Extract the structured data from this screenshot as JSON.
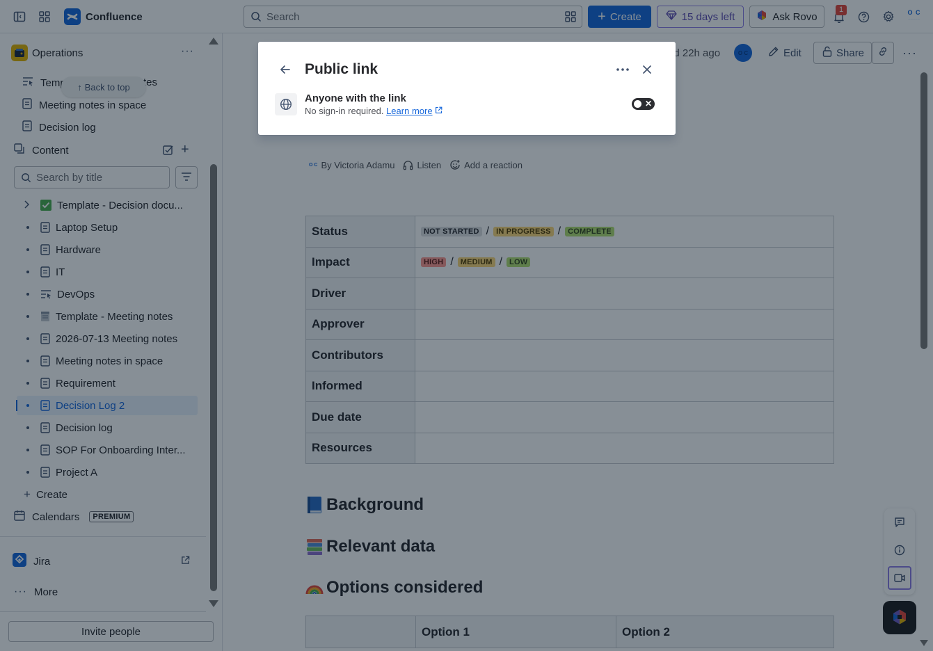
{
  "topbar": {
    "app_name": "Confluence",
    "search_placeholder": "Search",
    "create_label": "Create",
    "trial_label": "15 days left",
    "rovo_label": "Ask Rovo",
    "notification_count": "1",
    "avatar_initials": "O C"
  },
  "sidebar": {
    "space_name": "Operations",
    "nav_items": [
      {
        "label": "Templ",
        "icon": "template-icon"
      },
      {
        "label": "Meeting notes in space",
        "icon": "page-icon"
      },
      {
        "label": "Decision log",
        "icon": "page-icon"
      }
    ],
    "nav_item_0_suffix": "tes",
    "back_to_top": "Back to top",
    "content_label": "Content",
    "search_placeholder": "Search by title",
    "tree": [
      {
        "label": "Template - Decision docu...",
        "icon": "checkbox-icon",
        "expandable": true
      },
      {
        "label": "Laptop Setup",
        "icon": "page-icon"
      },
      {
        "label": "Hardware",
        "icon": "page-icon"
      },
      {
        "label": "IT",
        "icon": "page-icon"
      },
      {
        "label": "DevOps",
        "icon": "template-icon"
      },
      {
        "label": "Template - Meeting notes",
        "icon": "notepad-icon"
      },
      {
        "label": "2026-07-13 Meeting notes",
        "icon": "page-icon"
      },
      {
        "label": "Meeting notes in space",
        "icon": "page-icon"
      },
      {
        "label": "Requirement",
        "icon": "page-icon"
      },
      {
        "label": "Decision Log 2",
        "icon": "page-icon",
        "active": true
      },
      {
        "label": "Decision log",
        "icon": "page-icon"
      },
      {
        "label": "SOP For Onboarding Inter...",
        "icon": "page-icon"
      },
      {
        "label": "Project A",
        "icon": "page-icon"
      }
    ],
    "create_label": "Create",
    "calendars_label": "Calendars",
    "premium_badge": "PREMIUM",
    "jira_label": "Jira",
    "more_label": "More",
    "invite_label": "Invite people"
  },
  "page": {
    "updated_text": "ed 22h ago",
    "edit_label": "Edit",
    "share_label": "Share",
    "byline_author": "By Victoria Adamu",
    "listen_label": "Listen",
    "reaction_label": "Add a reaction",
    "properties": [
      {
        "key": "Status"
      },
      {
        "key": "Impact"
      },
      {
        "key": "Driver"
      },
      {
        "key": "Approver"
      },
      {
        "key": "Contributors"
      },
      {
        "key": "Informed"
      },
      {
        "key": "Due date"
      },
      {
        "key": "Resources"
      }
    ],
    "status_values": [
      "NOT STARTED",
      "IN PROGRESS",
      "COMPLETE"
    ],
    "impact_values": [
      "HIGH",
      "MEDIUM",
      "LOW"
    ],
    "separator": "/",
    "headings": [
      "Background",
      "Relevant data",
      "Options considered"
    ],
    "options_columns": [
      "",
      "Option 1",
      "Option 2"
    ]
  },
  "modal": {
    "title": "Public link",
    "link_title": "Anyone with the link",
    "link_sub": "No sign-in required.",
    "learn_more": "Learn more"
  },
  "colors": {
    "brand": "#1868DB",
    "lozenge_grey": "#DDDEE1",
    "lozenge_yellow": "#FBD779",
    "lozenge_green": "#B3DF72",
    "lozenge_red": "#FD9891"
  }
}
